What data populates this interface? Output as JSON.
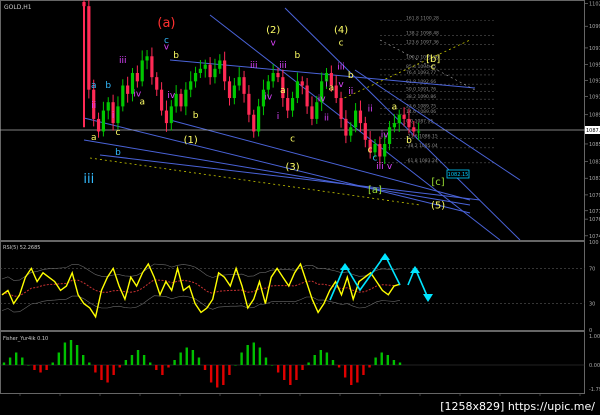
{
  "window": {
    "symbol_label": "GOLD,H1",
    "rsi_label": "RSI(5) 52.2685",
    "fisher_label": "Fisher_Yur4ik 0.10",
    "watermark": "[1258x829] https://upic.me/"
  },
  "colors": {
    "background": "#000000",
    "up_candle": "#00c800",
    "down_candle": "#ff2a55",
    "trendline": "#4a63d8",
    "rsi_line": "#ffff00",
    "rsi_ma": "#c83232",
    "arrow": "#00e5ff",
    "wave_yellow": "#ffff66",
    "wave_magenta": "#dd44ff",
    "wave_cyan": "#33bbff",
    "wave_red": "#ff3030",
    "wave_green": "#99dd33",
    "fisher_pos": "#00c000",
    "fisher_neg": "#e00000",
    "fib_text": "#888888"
  },
  "chart_data": [
    {
      "type": "candlestick",
      "panel": "price",
      "symbol": "GOLD",
      "timeframe": "H1",
      "y_ticks": [
        "1102.3",
        "1099.6",
        "1097.0",
        "1095.0",
        "1093.1",
        "1091.2",
        "1089.0",
        "1087.2",
        "1085.5",
        "1083.4",
        "1081.4",
        "1079.4",
        "1077.5",
        "1076.5",
        "1074.5"
      ],
      "ylim": [
        1074.0,
        1102.5
      ],
      "current_price_label": "1087.",
      "price_box": "1082.15",
      "closes": [
        1102.0,
        1092.0,
        1088.5,
        1087.0,
        1089.5,
        1090.5,
        1088.0,
        1090.0,
        1092.5,
        1091.5,
        1094.0,
        1093.0,
        1095.5,
        1096.0,
        1093.5,
        1092.0,
        1089.5,
        1088.0,
        1090.0,
        1091.5,
        1090.0,
        1092.0,
        1093.0,
        1094.0,
        1094.5,
        1095.0,
        1093.5,
        1094.5,
        1095.5,
        1093.0,
        1091.0,
        1092.5,
        1093.5,
        1091.5,
        1089.0,
        1087.0,
        1090.0,
        1092.0,
        1093.0,
        1094.0,
        1093.5,
        1091.0,
        1089.5,
        1091.0,
        1093.0,
        1092.5,
        1090.0,
        1088.5,
        1090.5,
        1093.0,
        1094.0,
        1092.5,
        1091.0,
        1088.5,
        1086.5,
        1087.5,
        1089.5,
        1088.0,
        1086.0,
        1084.5,
        1085.5,
        1084.0,
        1085.5,
        1087.5,
        1088.0,
        1089.0,
        1088.5,
        1087.5,
        1087.0,
        1087.0
      ],
      "fib_levels": [
        {
          "text": "161.8 1100.28",
          "value": 1100.3
        },
        {
          "text": "138.2 1098.48",
          "value": 1098.5
        },
        {
          "text": "123.6 1097.36",
          "value": 1097.4
        },
        {
          "text": "100.0 1095.56",
          "value": 1095.6
        },
        {
          "text": "85.4 1094.45",
          "value": 1094.45
        },
        {
          "text": "76.4 1093.77",
          "value": 1093.77
        },
        {
          "text": "61.8 1092.66",
          "value": 1092.66
        },
        {
          "text": "50.0 1091.76",
          "value": 1091.76
        },
        {
          "text": "38.2 1090.86",
          "value": 1090.86
        },
        {
          "text": "23.6 1089.75",
          "value": 1089.75
        },
        {
          "text": "14.6 1089.06",
          "value": 1089.06
        },
        {
          "text": "0.0 1087.95",
          "value": 1087.95
        },
        {
          "text": "-23.6 1086.15",
          "value": 1086.15
        },
        {
          "text": "-38.2 1085.04",
          "value": 1085.04
        },
        {
          "text": "-61.8 1083.24",
          "value": 1083.24
        }
      ],
      "wave_labels": [
        {
          "text": "(a)",
          "color": "wave_red",
          "size": 13,
          "bar": 17,
          "price": 1099.5
        },
        {
          "text": "c",
          "color": "wave_cyan",
          "size": 9,
          "bar": 17,
          "price": 1097.6
        },
        {
          "text": "v",
          "color": "wave_magenta",
          "size": 9,
          "bar": 17,
          "price": 1096.8
        },
        {
          "text": "b",
          "color": "wave_yellow",
          "size": 9,
          "bar": 19,
          "price": 1095.8
        },
        {
          "text": "iii",
          "color": "wave_magenta",
          "size": 9,
          "bar": 8,
          "price": 1095.2
        },
        {
          "text": "a",
          "color": "wave_cyan",
          "size": 9,
          "bar": 2,
          "price": 1092.2
        },
        {
          "text": "b",
          "color": "wave_cyan",
          "size": 9,
          "bar": 5,
          "price": 1092.2
        },
        {
          "text": "iv",
          "color": "wave_magenta",
          "size": 9,
          "bar": 11,
          "price": 1091.2
        },
        {
          "text": "iv",
          "color": "wave_magenta",
          "size": 9,
          "bar": 18,
          "price": 1091.0
        },
        {
          "text": "ii",
          "color": "wave_magenta",
          "size": 9,
          "bar": 2,
          "price": 1089.8
        },
        {
          "text": "i",
          "color": "wave_magenta",
          "size": 9,
          "bar": 6,
          "price": 1088.6
        },
        {
          "text": "a",
          "color": "wave_yellow",
          "size": 9,
          "bar": 12,
          "price": 1090.2
        },
        {
          "text": "iii",
          "color": "wave_cyan",
          "size": 13,
          "bar": 1,
          "price": 1080.8
        },
        {
          "text": "a",
          "color": "wave_yellow",
          "size": 9,
          "bar": 2,
          "price": 1086.0
        },
        {
          "text": "b",
          "color": "wave_cyan",
          "size": 9,
          "bar": 7,
          "price": 1084.2
        },
        {
          "text": "c",
          "color": "wave_yellow",
          "size": 9,
          "bar": 7,
          "price": 1086.6
        },
        {
          "text": "b",
          "color": "wave_yellow",
          "size": 9,
          "bar": 23,
          "price": 1088.6
        },
        {
          "text": "(1)",
          "color": "wave_yellow",
          "size": 10,
          "bar": 22,
          "price": 1085.6
        },
        {
          "text": "(2)",
          "color": "wave_yellow",
          "size": 10,
          "bar": 39,
          "price": 1098.8
        },
        {
          "text": "v",
          "color": "wave_magenta",
          "size": 9,
          "bar": 39,
          "price": 1097.3
        },
        {
          "text": "b",
          "color": "wave_yellow",
          "size": 9,
          "bar": 44,
          "price": 1095.8
        },
        {
          "text": "iii",
          "color": "wave_magenta",
          "size": 9,
          "bar": 35,
          "price": 1094.6
        },
        {
          "text": "iii",
          "color": "wave_magenta",
          "size": 9,
          "bar": 41,
          "price": 1094.6
        },
        {
          "text": "iv",
          "color": "wave_magenta",
          "size": 9,
          "bar": 38,
          "price": 1090.8
        },
        {
          "text": "a",
          "color": "wave_yellow",
          "size": 9,
          "bar": 41,
          "price": 1091.6
        },
        {
          "text": "c",
          "color": "wave_yellow",
          "size": 9,
          "bar": 43,
          "price": 1085.8
        },
        {
          "text": "(3)",
          "color": "wave_yellow",
          "size": 10,
          "bar": 43,
          "price": 1082.4
        },
        {
          "text": "i",
          "color": "wave_magenta",
          "size": 9,
          "bar": 40,
          "price": 1088.5
        },
        {
          "text": "ii",
          "color": "wave_magenta",
          "size": 9,
          "bar": 50,
          "price": 1088.3
        },
        {
          "text": "iv",
          "color": "wave_magenta",
          "size": 9,
          "bar": 49,
          "price": 1090.6
        },
        {
          "text": "(4)",
          "color": "wave_yellow",
          "size": 10,
          "bar": 53,
          "price": 1098.8
        },
        {
          "text": "c",
          "color": "wave_yellow",
          "size": 9,
          "bar": 53,
          "price": 1097.3
        },
        {
          "text": "iii",
          "color": "wave_magenta",
          "size": 9,
          "bar": 53,
          "price": 1094.4
        },
        {
          "text": "b",
          "color": "wave_yellow",
          "size": 9,
          "bar": 55,
          "price": 1093.4
        },
        {
          "text": "v",
          "color": "wave_magenta",
          "size": 9,
          "bar": 53,
          "price": 1092.3
        },
        {
          "text": "i",
          "color": "wave_magenta",
          "size": 9,
          "bar": 50,
          "price": 1092.4
        },
        {
          "text": "a",
          "color": "wave_yellow",
          "size": 9,
          "bar": 51,
          "price": 1091.9
        },
        {
          "text": "ii",
          "color": "wave_magenta",
          "size": 9,
          "bar": 55,
          "price": 1091.5
        },
        {
          "text": "ii",
          "color": "wave_magenta",
          "size": 9,
          "bar": 59,
          "price": 1089.4
        },
        {
          "text": "iv",
          "color": "wave_magenta",
          "size": 9,
          "bar": 62,
          "price": 1086.3
        },
        {
          "text": "c",
          "color": "wave_yellow",
          "size": 9,
          "bar": 59,
          "price": 1084.5
        },
        {
          "text": "iii",
          "color": "wave_magenta",
          "size": 9,
          "bar": 61,
          "price": 1082.5
        },
        {
          "text": "v",
          "color": "wave_magenta",
          "size": 9,
          "bar": 63,
          "price": 1082.5
        },
        {
          "text": "[a]",
          "color": "wave_green",
          "size": 10,
          "bar": 60,
          "price": 1079.6
        },
        {
          "text": "a",
          "color": "wave_yellow",
          "size": 9,
          "bar": 64,
          "price": 1089.6
        },
        {
          "text": "b",
          "color": "wave_yellow",
          "size": 9,
          "bar": 67,
          "price": 1085.6
        },
        {
          "text": "c",
          "color": "wave_cyan",
          "size": 9,
          "bar": 60,
          "price": 1083.5
        },
        {
          "text": "[b]",
          "color": "wave_yellow",
          "size": 10,
          "bar": 72,
          "price": 1095.3
        },
        {
          "text": "c",
          "color": "wave_yellow",
          "size": 9,
          "bar": 72,
          "price": 1094.4
        },
        {
          "text": "[c]",
          "color": "wave_green",
          "size": 10,
          "bar": 73,
          "price": 1080.6
        },
        {
          "text": "(5)",
          "color": "wave_yellow",
          "size": 10,
          "bar": 73,
          "price": 1077.8
        }
      ]
    },
    {
      "type": "line",
      "panel": "rsi",
      "name": "RSI(5)",
      "current": 52.2685,
      "ylim": [
        0,
        100
      ],
      "levels": [
        70,
        30
      ],
      "y_ticks": [
        "100",
        "70",
        "30",
        "0"
      ],
      "values": [
        40,
        45,
        30,
        40,
        60,
        70,
        55,
        65,
        60,
        55,
        45,
        50,
        65,
        40,
        30,
        25,
        15,
        45,
        60,
        70,
        50,
        35,
        60,
        50,
        65,
        75,
        60,
        40,
        55,
        45,
        70,
        45,
        50,
        30,
        20,
        25,
        35,
        65,
        60,
        50,
        70,
        50,
        25,
        35,
        55,
        30,
        60,
        70,
        60,
        50,
        65,
        75,
        55,
        35,
        20,
        30,
        45,
        55,
        40,
        60,
        35,
        55,
        60,
        65,
        55,
        45,
        40,
        50,
        52
      ]
    },
    {
      "type": "bar",
      "panel": "fisher",
      "name": "Fisher_Yur4ik",
      "current": 0.1,
      "ylim": [
        -1.0,
        1.1
      ],
      "y_ticks": [
        "1.002",
        "0.00",
        "-1.797"
      ],
      "values": [
        0.1,
        0.3,
        0.5,
        0.3,
        0.0,
        -0.2,
        -0.3,
        -0.2,
        0.1,
        0.5,
        0.9,
        1.0,
        0.8,
        0.4,
        0.1,
        -0.3,
        -0.6,
        -0.7,
        -0.4,
        -0.1,
        0.2,
        0.4,
        0.6,
        0.4,
        0.1,
        -0.2,
        -0.4,
        -0.1,
        0.2,
        0.5,
        0.7,
        0.6,
        0.3,
        -0.2,
        -0.7,
        -0.9,
        -0.8,
        -0.4,
        0.0,
        0.5,
        0.8,
        0.9,
        0.7,
        0.3,
        0.0,
        -0.3,
        -0.6,
        -0.8,
        -0.6,
        -0.2,
        0.1,
        0.4,
        0.6,
        0.5,
        0.2,
        -0.1,
        -0.5,
        -0.8,
        -0.7,
        -0.4,
        -0.1,
        0.3,
        0.5,
        0.4,
        0.2,
        0.1
      ]
    }
  ]
}
